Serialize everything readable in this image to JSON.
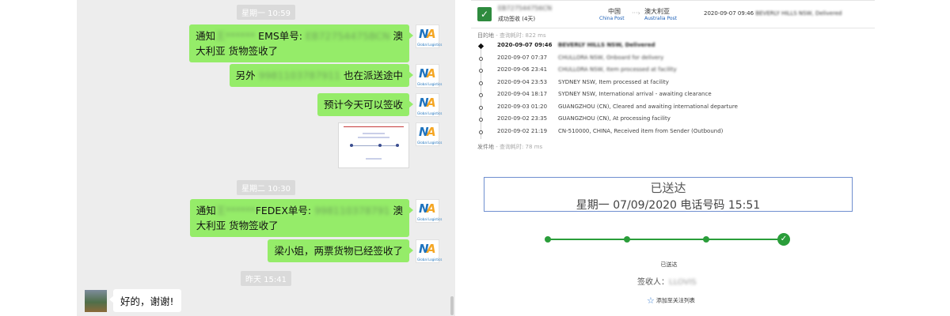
{
  "chat": {
    "timestamps": [
      "星期一 10:59",
      "星期二 10:30",
      "昨天 15:41"
    ],
    "messages": [
      {
        "pre": "通知",
        "blur1": "王******",
        "mid": " EMS单号: ",
        "blur2": "EB72754475BCN",
        "post": " 澳",
        "line2": "大利亚 货物签收了"
      },
      {
        "pre": "另外 ",
        "blur1": "9981103787911",
        "post": " 也在派送途中"
      },
      {
        "text": "预计今天可以签收"
      },
      {
        "pre": "通知",
        "blur1": "王******",
        "mid": "FEDEX单号: ",
        "blur2": "998110378791",
        "post": " 澳",
        "line2": "大利亚 货物签收了"
      },
      {
        "text": "梁小姐，两票货物已经签收了"
      }
    ],
    "reply": "好的，谢谢!",
    "avatar_logo": {
      "text": "Global Logistics"
    }
  },
  "tracking": {
    "header": {
      "tracking_number": "EB727544756CN",
      "status": "成功签收 (4天)",
      "origin": "中国",
      "origin_carrier": "China Post",
      "destination": "澳大利亚",
      "destination_carrier": "Australia Post",
      "latest_time": "2020-09-07 09:46",
      "latest_desc": "BEVERLY HILLS NSW, Delivered"
    },
    "dest_meta": {
      "label": "目的地",
      "time": " - 查询耗时: 822 ms"
    },
    "origin_meta": {
      "label": "发件地",
      "time": " - 查询耗时: 78 ms"
    },
    "events": [
      {
        "time": "2020-09-07 09:46",
        "desc": "BEVERLY HILLS NSW, Delivered"
      },
      {
        "time": "2020-09-07 07:37",
        "desc": "CHULLORA NSW, Onboard for delivery"
      },
      {
        "time": "2020-09-06 23:41",
        "desc": "CHULLORA NSW, Item processed at facility"
      },
      {
        "time": "2020-09-04 23:53",
        "desc": "SYDNEY NSW, Item processed at facility"
      },
      {
        "time": "2020-09-04 18:17",
        "desc": "SYDNEY NSW, International arrival - awaiting clearance"
      },
      {
        "time": "2020-09-03 01:20",
        "desc": "GUANGZHOU (CN), Cleared and awaiting international departure"
      },
      {
        "time": "2020-09-02 23:35",
        "desc": "GUANGZHOU (CN), At processing facility"
      },
      {
        "time": "2020-09-02 21:19",
        "desc": "CN-510000, CHINA, Received item from Sender (Outbound)"
      }
    ],
    "delivered": {
      "title": "已送达",
      "subtitle": "星期一 07/09/2020 电话号码 15:51"
    },
    "progress": {
      "steps_total": 4,
      "steps_done": 4,
      "label": "已送达"
    },
    "receiver": {
      "label": "签收人：",
      "value": "LLOVIS"
    },
    "follow": "添加至关注列表",
    "colors": {
      "accent": "#2a9d3a",
      "bubble": "#95ec69",
      "box_border": "#6f8fcf"
    }
  }
}
